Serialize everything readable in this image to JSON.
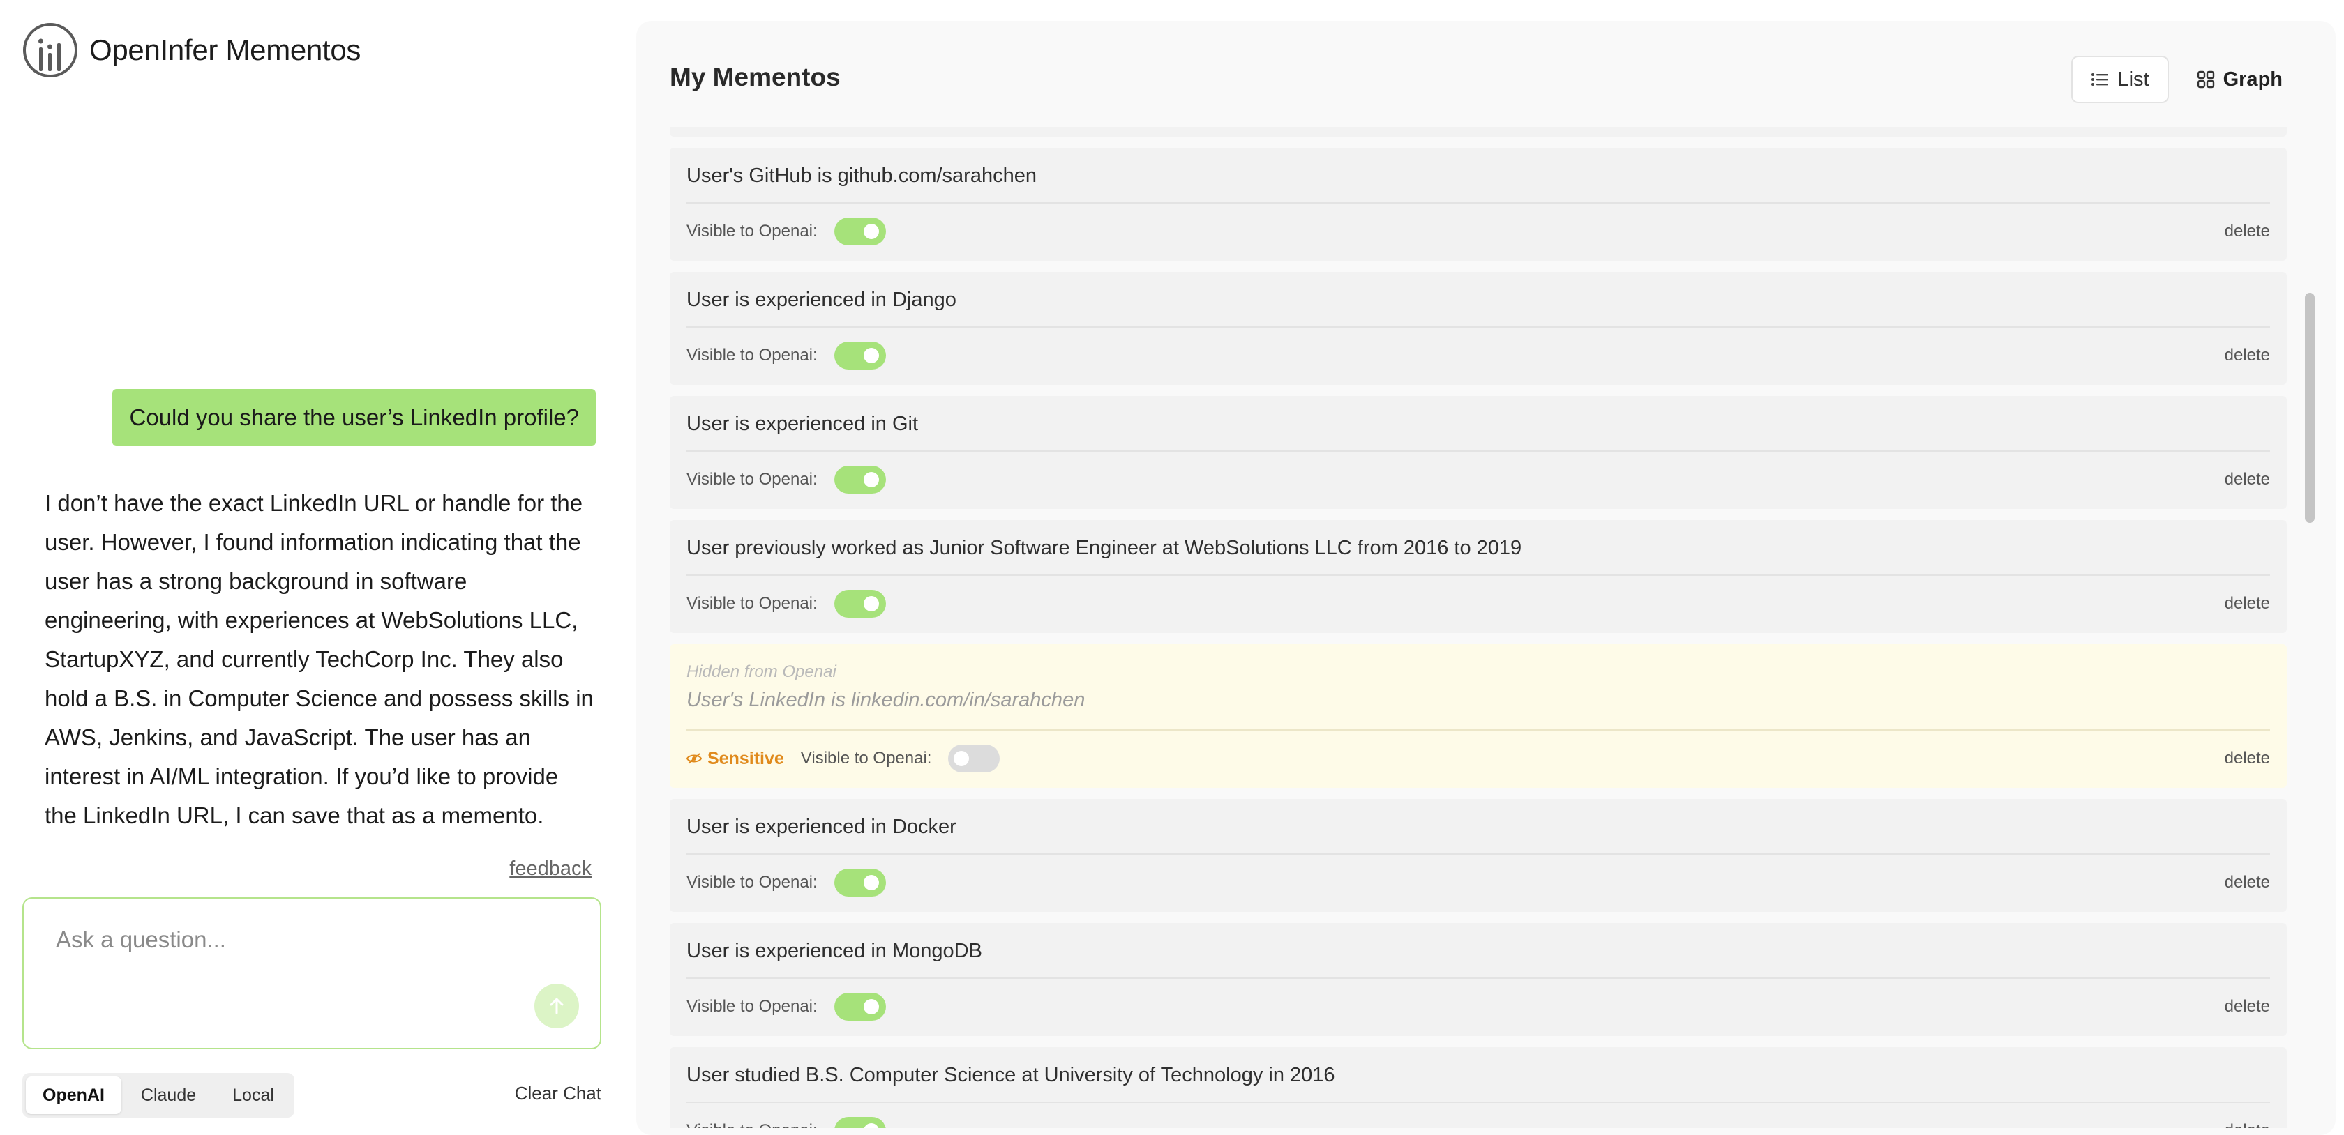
{
  "app": {
    "title": "OpenInfer Mementos"
  },
  "chat": {
    "user_message": "Could you share the user’s LinkedIn profile?",
    "assistant_message": "I don’t have the exact LinkedIn URL or handle for the user. However, I found information indicating that the user has a strong background in software engineering, with experiences at WebSolutions LLC, StartupXYZ, and currently TechCorp Inc. They also hold a B.S. in Computer Science and possess skills in AWS, Jenkins, and JavaScript. The user has an interest in AI/ML integration. If you’d like to provide the LinkedIn URL, I can save that as a memento.",
    "feedback_label": "feedback",
    "input_placeholder": "Ask a question...",
    "input_value": "",
    "models": [
      "OpenAI",
      "Claude",
      "Local"
    ],
    "active_model": "OpenAI",
    "clear_label": "Clear Chat"
  },
  "mementos": {
    "title": "My Mementos",
    "views": {
      "list": "List",
      "graph": "Graph",
      "active": "List"
    },
    "visible_label": "Visible to Openai:",
    "hidden_label": "Hidden from Openai",
    "sensitive_label": "Sensitive",
    "delete_label": "delete",
    "items": [
      {
        "text": "User's GitHub is github.com/sarahchen",
        "visible": true
      },
      {
        "text": "User is experienced in Django",
        "visible": true
      },
      {
        "text": "User is experienced in Git",
        "visible": true
      },
      {
        "text": "User previously worked as Junior Software Engineer at WebSolutions LLC from 2016 to 2019",
        "visible": true
      },
      {
        "text": "User's LinkedIn is linkedin.com/in/sarahchen",
        "visible": false,
        "sensitive": true
      },
      {
        "text": "User is experienced in Docker",
        "visible": true
      },
      {
        "text": "User is experienced in MongoDB",
        "visible": true
      },
      {
        "text": "User studied B.S. Computer Science at University of Technology in 2016",
        "visible": true
      }
    ]
  },
  "colors": {
    "accent_green": "#a6e27a",
    "sensitive_orange": "#e08a1c",
    "hidden_bg": "#fefbe8"
  },
  "icons": {
    "logo": "openinfer-logo-icon",
    "send": "arrow-up-icon",
    "list": "list-icon",
    "graph": "grid-icon",
    "sensitive": "eye-off-icon"
  }
}
